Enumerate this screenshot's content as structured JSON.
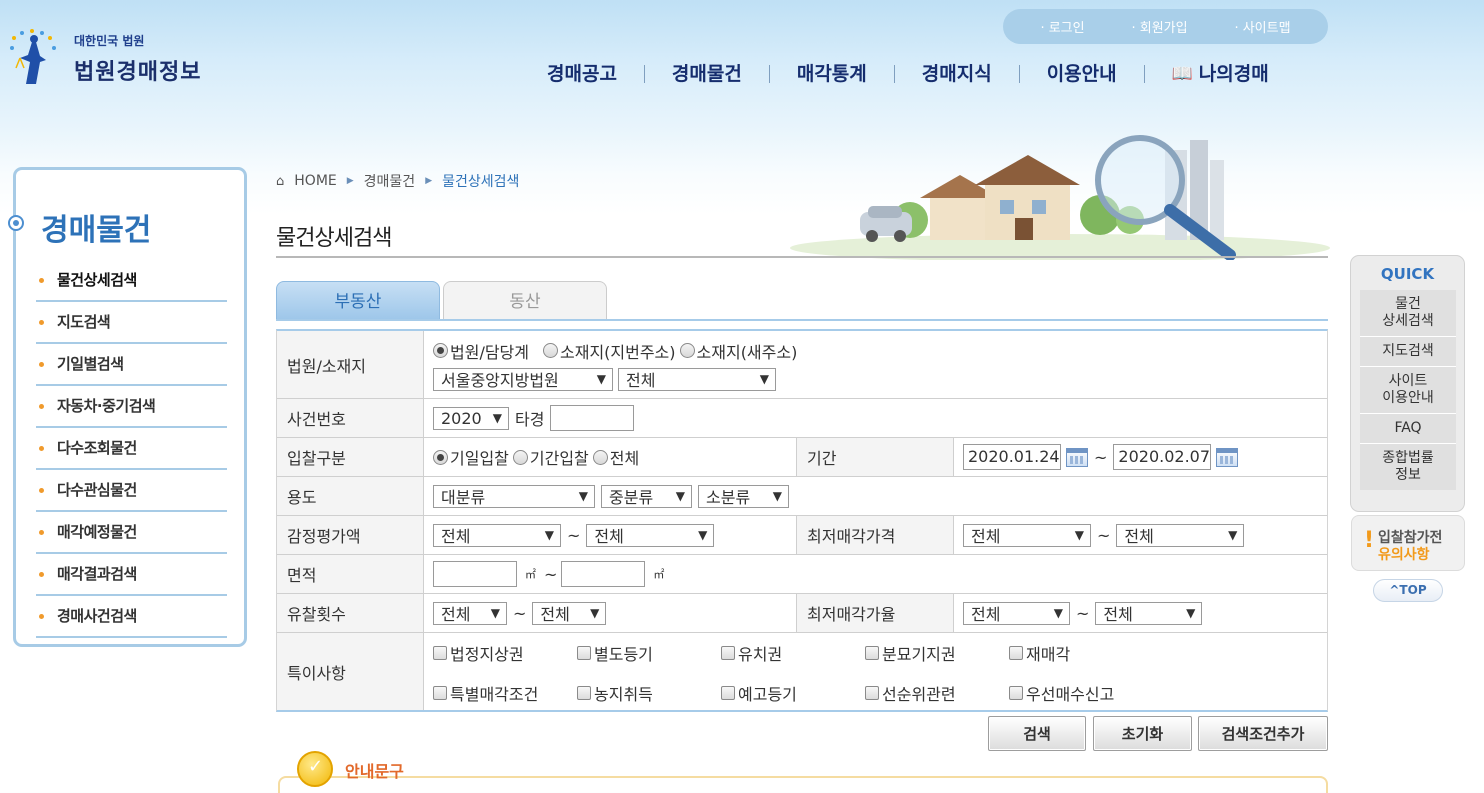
{
  "brand": {
    "small": "대한민국 법원",
    "big": "법원경매정보"
  },
  "toplinks": [
    "로그인",
    "회원가입",
    "사이트맵"
  ],
  "gnb": [
    "경매공고",
    "경매물건",
    "매각통계",
    "경매지식",
    "이용안내",
    "나의경매"
  ],
  "lnb": {
    "title": "경매물건",
    "items": [
      "물건상세검색",
      "지도검색",
      "기일별검색",
      "자동차·중기검색",
      "다수조회물건",
      "다수관심물건",
      "매각예정물건",
      "매각결과검색",
      "경매사건검색"
    ]
  },
  "breadcrumb": {
    "home": "HOME",
    "level1": "경매물건",
    "current": "물건상세검색"
  },
  "page_title": "물건상세검색",
  "tabs": {
    "active": "부동산",
    "inactive": "동산"
  },
  "form": {
    "court": {
      "label": "법원/소재지",
      "radios": [
        "법원/담당계",
        "소재지(지번주소)",
        "소재지(새주소)"
      ],
      "court_select": "서울중앙지방법원",
      "dept_select": "전체"
    },
    "case_no": {
      "label": "사건번호",
      "year": "2020",
      "type": "타경",
      "number": ""
    },
    "bid_type": {
      "label": "입찰구분",
      "radios": [
        "기일입찰",
        "기간입찰",
        "전체"
      ]
    },
    "period": {
      "label": "기간",
      "from": "2020.01.24",
      "to": "2020.02.07"
    },
    "usage": {
      "label": "용도",
      "major": "대분류",
      "middle": "중분류",
      "minor": "소분류"
    },
    "appraisal": {
      "label": "감정평가액",
      "from": "전체",
      "to": "전체"
    },
    "min_price": {
      "label": "최저매각가격",
      "from": "전체",
      "to": "전체"
    },
    "area": {
      "label": "면적",
      "unit": "㎡",
      "from": "",
      "to": ""
    },
    "fail_count": {
      "label": "유찰횟수",
      "from": "전체",
      "to": "전체"
    },
    "min_rate": {
      "label": "최저매각가율",
      "from": "전체",
      "to": "전체"
    },
    "special": {
      "label": "특이사항",
      "items": [
        "법정지상권",
        "별도등기",
        "유치권",
        "분묘기지권",
        "재매각",
        "특별매각조건",
        "농지취득",
        "예고등기",
        "선순위관련",
        "우선매수신고"
      ]
    }
  },
  "tilde": "~",
  "buttons": {
    "search": "검색",
    "reset": "초기화",
    "add": "검색조건추가"
  },
  "info_title": "안내문구",
  "quick": {
    "title": "QUICK",
    "items": [
      "물건\n상세검색",
      "지도검색",
      "사이트\n이용안내",
      "FAQ",
      "종합법률\n정보"
    ],
    "warn_line1": "입찰참가전",
    "warn_line2": "유의사항",
    "top": "^TOP"
  },
  "colors": {
    "accent": "#2d72b8",
    "gnb": "#152d6e",
    "orange": "#f09a2c"
  }
}
